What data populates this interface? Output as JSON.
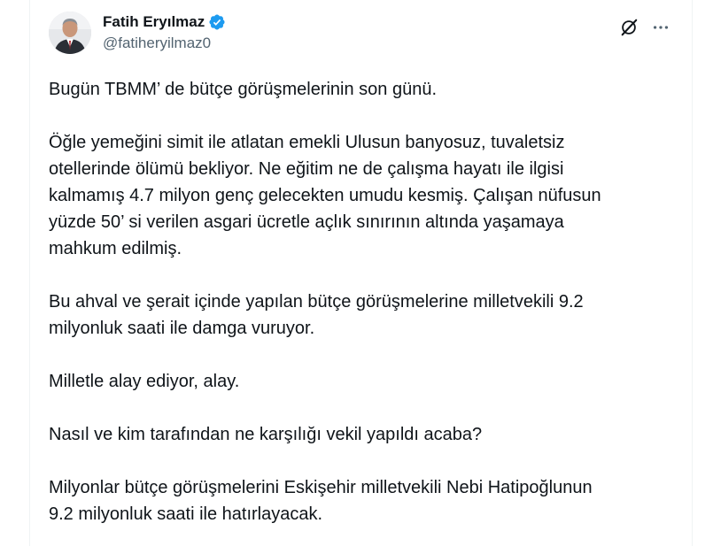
{
  "author": {
    "display_name": "Fatih Eryılmaz",
    "handle": "@fatiheryilmaz0",
    "verified": true
  },
  "icons": {
    "verified": "verified-badge-icon",
    "grok": "grok-icon",
    "more": "more-options-icon"
  },
  "colors": {
    "verified_blue": "#1d9bf0",
    "text_primary": "#0f1419",
    "text_secondary": "#536471"
  },
  "tweet": {
    "paragraphs": [
      [
        "Bugün TBMM’ de bütçe görüşmelerinin son günü."
      ],
      [
        "Öğle yemeğini simit ile atlatan emekli Ulusun banyosuz, tuvaletsiz",
        "otellerinde ölümü bekliyor. Ne eğitim ne de çalışma hayatı ile ilgisi",
        "kalmamış 4.7 milyon genç  gelecekten umudu kesmiş. Çalışan nüfusun",
        "yüzde 50’ si verilen asgari ücretle açlık sınırının altında yaşamaya",
        "mahkum edilmiş."
      ],
      [
        "Bu ahval ve şerait içinde yapılan bütçe görüşmelerine milletvekili 9.2",
        "milyonluk saati ile damga vuruyor."
      ],
      [
        "Milletle alay ediyor, alay."
      ],
      [
        "Nasıl ve kim tarafından ne karşılığı vekil yapıldı acaba?"
      ],
      [
        "Milyonlar bütçe görüşmelerini Eskişehir milletvekili Nebi Hatipoğlunun",
        "9.2 milyonluk saati ile hatırlayacak."
      ]
    ]
  }
}
